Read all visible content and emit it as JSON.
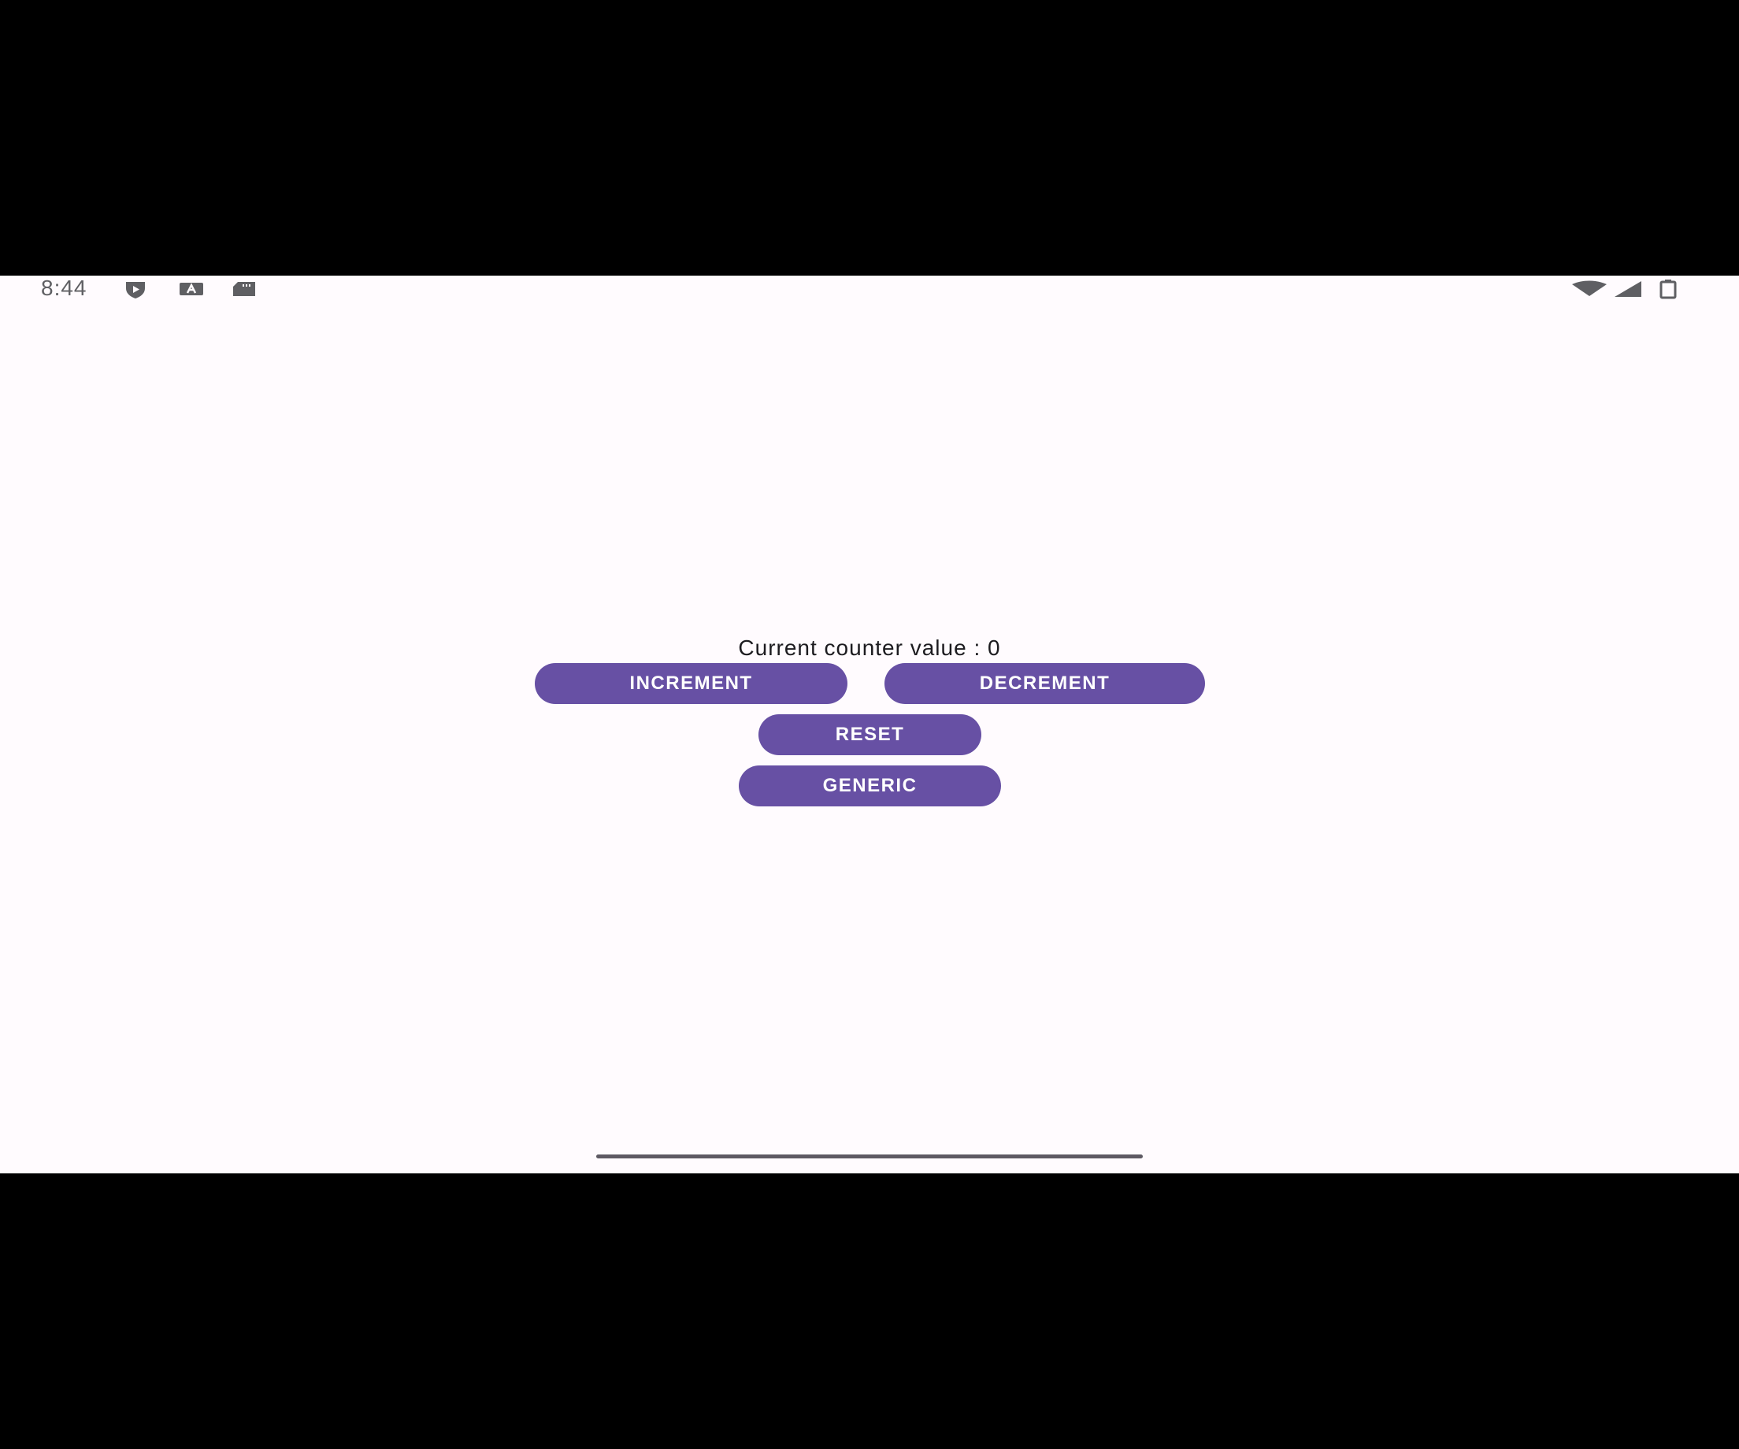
{
  "status_bar": {
    "time": "8:44",
    "left_icons": [
      "shield-play-icon",
      "keyboard-icon",
      "sd-card-icon"
    ],
    "right_icons": [
      "wifi-icon",
      "cell-signal-icon",
      "battery-icon"
    ]
  },
  "main": {
    "counter_label": "Current counter value : 0",
    "buttons": {
      "increment": "INCREMENT",
      "decrement": "DECREMENT",
      "reset": "RESET",
      "generic": "GENERIC"
    }
  },
  "colors": {
    "background": "#fffbfe",
    "button": "#6750a4",
    "button_text": "#ffffff",
    "text": "#1c1b1f",
    "status_icons": "#5f5f63",
    "letterbox": "#000000"
  }
}
